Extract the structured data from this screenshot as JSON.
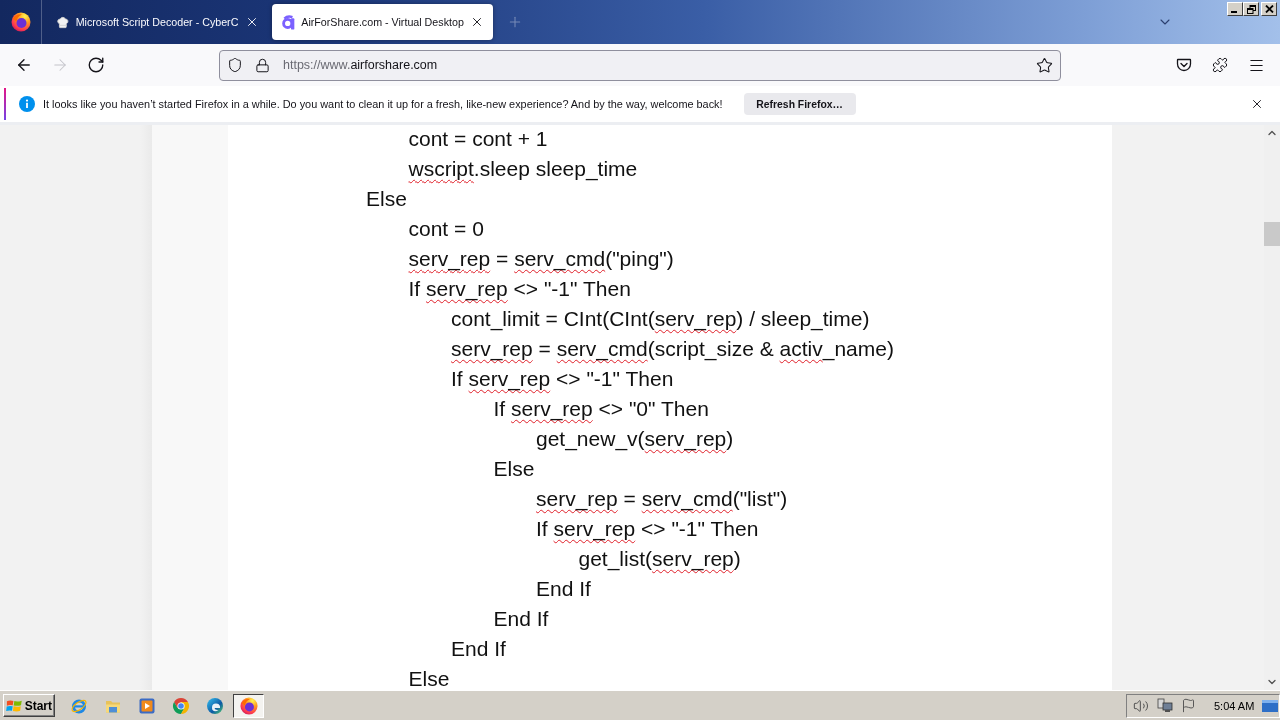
{
  "tab_strip": {
    "tabs": [
      {
        "title": "Microsoft Script Decoder - CyberC",
        "selected": false
      },
      {
        "title": "AirForShare.com - Virtual Desktop",
        "selected": true
      }
    ]
  },
  "toolbar": {
    "nav": [
      {
        "disabled": false
      },
      {
        "disabled": true
      },
      {
        "disabled": false
      }
    ],
    "url": {
      "scheme": "https://www.",
      "host": "airforshare.com"
    }
  },
  "notification": {
    "message": "It looks like you haven’t started Firefox in a while. Do you want to clean it up for a fresh, like-new experience? And by the way, welcome back!",
    "button": "Refresh Firefox…"
  },
  "document": {
    "lines": [
      {
        "children": [
          {
            "parts": [
              {
                "text": "cont = cont + 1",
                "misspelled": false
              }
            ]
          },
          {
            "parts": [
              {
                "text": "wscript",
                "misspelled": true
              },
              {
                "text": ".sleep sleep_time",
                "misspelled": false
              }
            ]
          }
        ]
      },
      {
        "parts": [
          {
            "text": "Else",
            "misspelled": false
          }
        ],
        "children": [
          {
            "parts": [
              {
                "text": "cont = 0",
                "misspelled": false
              }
            ]
          },
          {
            "parts": [
              {
                "text": "serv_rep",
                "misspelled": true
              },
              {
                "text": " = ",
                "misspelled": false
              },
              {
                "text": "serv_cmd",
                "misspelled": true
              },
              {
                "text": "(\"ping\")",
                "misspelled": false
              }
            ]
          },
          {
            "parts": [
              {
                "text": "If ",
                "misspelled": false
              },
              {
                "text": "serv_rep",
                "misspelled": true
              },
              {
                "text": " <> \"-1\" Then",
                "misspelled": false
              }
            ],
            "children": [
              {
                "parts": [
                  {
                    "text": "cont_limit = CInt(CInt(",
                    "misspelled": false
                  },
                  {
                    "text": "serv_rep",
                    "misspelled": true
                  },
                  {
                    "text": ") / sleep_time)",
                    "misspelled": false
                  }
                ]
              },
              {
                "parts": [
                  {
                    "text": "serv_rep",
                    "misspelled": true
                  },
                  {
                    "text": " = ",
                    "misspelled": false
                  },
                  {
                    "text": "serv_cmd",
                    "misspelled": true
                  },
                  {
                    "text": "(script_size & ",
                    "misspelled": false
                  },
                  {
                    "text": "activ",
                    "misspelled": true
                  },
                  {
                    "text": "_name)",
                    "misspelled": false
                  }
                ]
              },
              {
                "parts": [
                  {
                    "text": "If ",
                    "misspelled": false
                  },
                  {
                    "text": "serv_rep",
                    "misspelled": true
                  },
                  {
                    "text": " <> \"-1\" Then",
                    "misspelled": false
                  }
                ],
                "children": [
                  {
                    "parts": [
                      {
                        "text": "If ",
                        "misspelled": false
                      },
                      {
                        "text": "serv_rep",
                        "misspelled": true
                      },
                      {
                        "text": " <> \"0\" Then",
                        "misspelled": false
                      }
                    ],
                    "children": [
                      {
                        "parts": [
                          {
                            "text": "get_new_v(",
                            "misspelled": false
                          },
                          {
                            "text": "serv_rep",
                            "misspelled": true
                          },
                          {
                            "text": ")",
                            "misspelled": false
                          }
                        ]
                      }
                    ]
                  },
                  {
                    "parts": [
                      {
                        "text": "Else",
                        "misspelled": false
                      }
                    ],
                    "children": [
                      {
                        "parts": [
                          {
                            "text": "serv_rep",
                            "misspelled": true
                          },
                          {
                            "text": " = ",
                            "misspelled": false
                          },
                          {
                            "text": "serv_cmd",
                            "misspelled": true
                          },
                          {
                            "text": "(\"list\")",
                            "misspelled": false
                          }
                        ]
                      },
                      {
                        "parts": [
                          {
                            "text": "If ",
                            "misspelled": false
                          },
                          {
                            "text": "serv_rep",
                            "misspelled": true
                          },
                          {
                            "text": " <> \"-1\" Then",
                            "misspelled": false
                          }
                        ],
                        "children": [
                          {
                            "parts": [
                              {
                                "text": "get_list(",
                                "misspelled": false
                              },
                              {
                                "text": "serv_rep",
                                "misspelled": true
                              },
                              {
                                "text": ")",
                                "misspelled": false
                              }
                            ]
                          }
                        ]
                      },
                      {
                        "parts": [
                          {
                            "text": "End If",
                            "misspelled": false
                          }
                        ]
                      }
                    ]
                  },
                  {
                    "parts": [
                      {
                        "text": "End If",
                        "misspelled": false
                      }
                    ]
                  }
                ]
              },
              {
                "parts": [
                  {
                    "text": "End If",
                    "misspelled": false
                  }
                ]
              }
            ]
          },
          {
            "parts": [
              {
                "text": "Else",
                "misspelled": false
              }
            ]
          }
        ]
      }
    ]
  },
  "taskbar": {
    "start": "Start",
    "apps": [
      {
        "selected": false
      },
      {
        "selected": false
      },
      {
        "selected": false
      },
      {
        "selected": false
      },
      {
        "selected": false
      },
      {
        "selected": true
      }
    ],
    "clock": "5:04 AM"
  }
}
